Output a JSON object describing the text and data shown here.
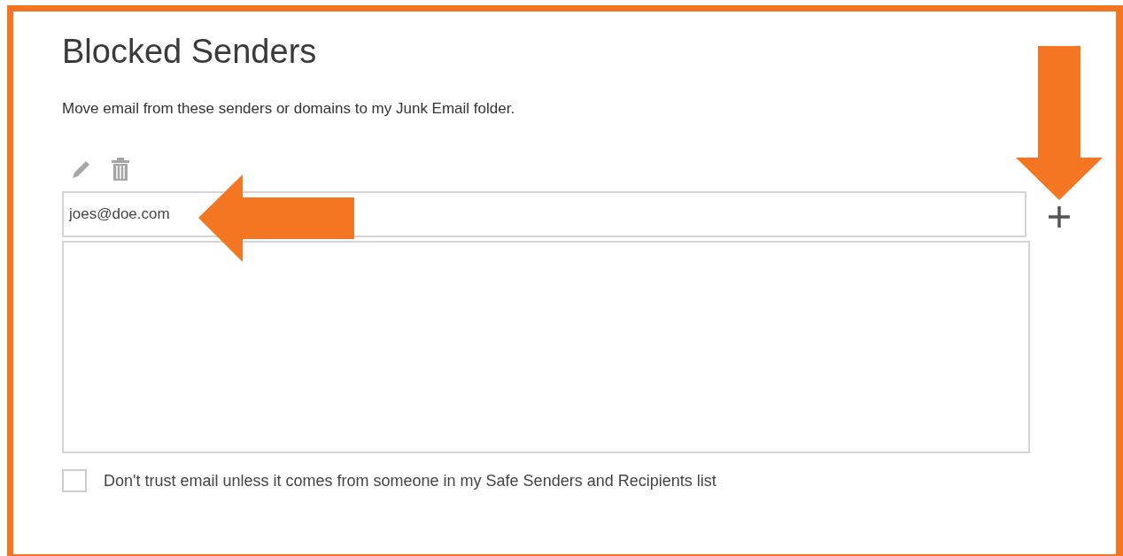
{
  "title": "Blocked Senders",
  "description": "Move email from these senders or domains to my Junk Email folder.",
  "sender_input": {
    "value": "joes@doe.com"
  },
  "option": {
    "label": "Don't trust email unless it comes from someone in my Safe Senders and Recipients list",
    "checked": false
  }
}
